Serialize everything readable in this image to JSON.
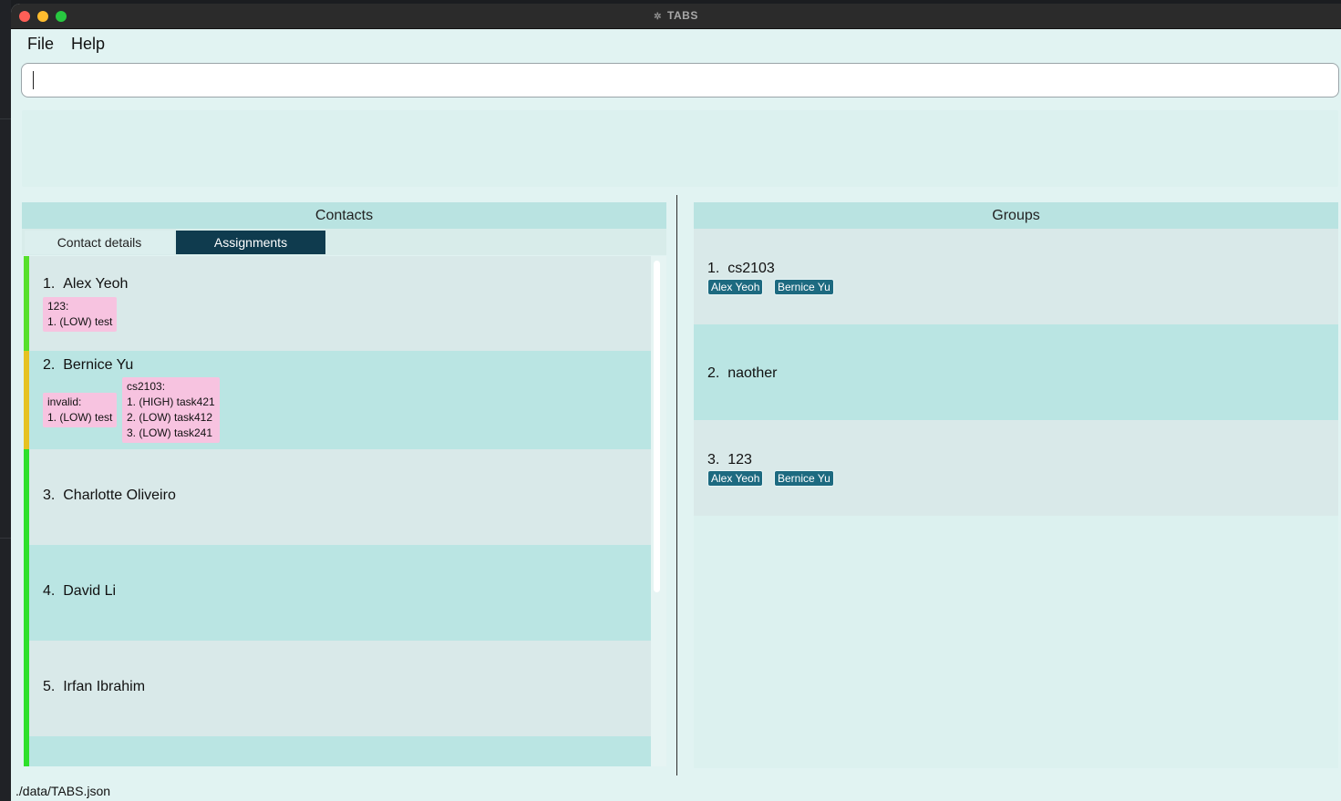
{
  "window": {
    "title": "TABS",
    "app_icon": "gear-icon"
  },
  "menu": {
    "file": "File",
    "help": "Help"
  },
  "command": {
    "value": ""
  },
  "result": {
    "text": ""
  },
  "contacts": {
    "header": "Contacts",
    "tabs": {
      "details": "Contact details",
      "assignments": "Assignments"
    },
    "items": [
      {
        "index": "1.",
        "name": "Alex Yeoh",
        "status_color": "#57e02b",
        "assignments": [
          {
            "text": "123:\n1. (LOW) test"
          }
        ]
      },
      {
        "index": "2.",
        "name": "Bernice Yu",
        "status_color": "#e6c221",
        "assignments": [
          {
            "text": "invalid:\n1. (LOW) test"
          },
          {
            "text": "cs2103:\n1. (HIGH) task421\n2. (LOW) task412\n3. (LOW) task241"
          }
        ]
      },
      {
        "index": "3.",
        "name": "Charlotte Oliveiro",
        "status_color": "#2ee02b",
        "assignments": []
      },
      {
        "index": "4.",
        "name": "David Li",
        "status_color": "#2ee02b",
        "assignments": []
      },
      {
        "index": "5.",
        "name": "Irfan Ibrahim",
        "status_color": "#2ee02b",
        "assignments": []
      },
      {
        "index": "",
        "name": "",
        "status_color": "#2ee02b",
        "assignments": []
      }
    ]
  },
  "groups": {
    "header": "Groups",
    "items": [
      {
        "index": "1.",
        "name": "cs2103",
        "members": [
          "Alex Yeoh",
          "Bernice Yu"
        ]
      },
      {
        "index": "2.",
        "name": "naother",
        "members": []
      },
      {
        "index": "3.",
        "name": "123",
        "members": [
          "Alex Yeoh",
          "Bernice Yu"
        ]
      }
    ]
  },
  "status": {
    "path": "./data/TABS.json"
  },
  "colors": {
    "accent": "#0f3b4e",
    "tag": "#1d6a80",
    "assignment": "#f7c3e0"
  }
}
